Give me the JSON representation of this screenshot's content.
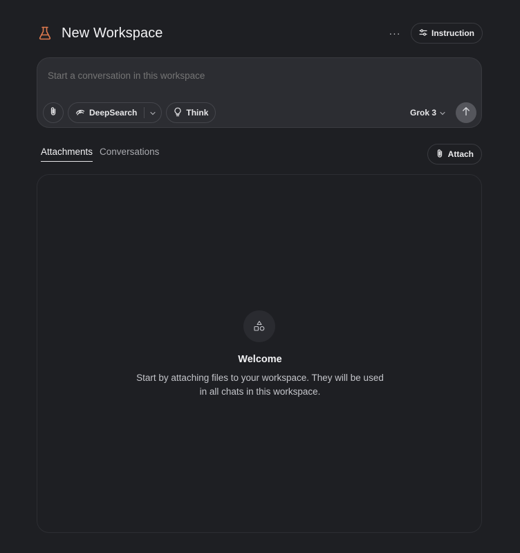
{
  "header": {
    "title": "New Workspace",
    "icon": "flask-icon",
    "accent_color": "#e07a4f",
    "more_label": "···",
    "instruction_label": "Instruction"
  },
  "composer": {
    "placeholder": "Start a conversation in this workspace",
    "deepsearch_label": "DeepSearch",
    "think_label": "Think",
    "model_label": "Grok 3"
  },
  "tabs": [
    {
      "label": "Attachments",
      "active": true
    },
    {
      "label": "Conversations",
      "active": false
    }
  ],
  "attach_label": "Attach",
  "empty_state": {
    "icon": "shapes-icon",
    "title": "Welcome",
    "text": "Start by attaching files to your workspace. They will be used in all chats in this workspace."
  }
}
